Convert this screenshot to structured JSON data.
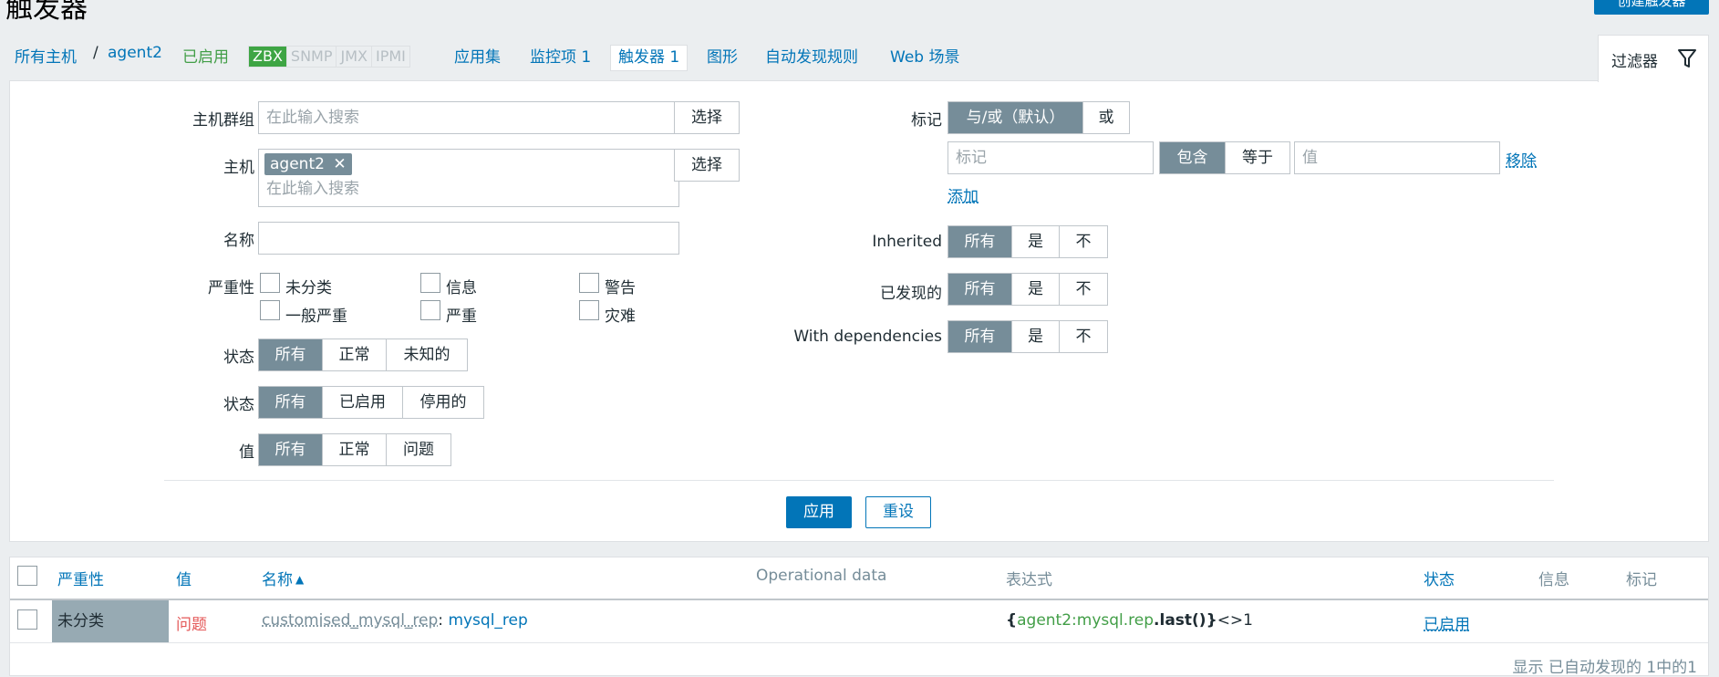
{
  "page": {
    "title": "触发器",
    "create_button": "创建触发器"
  },
  "nav": {
    "all_hosts": "所有主机",
    "separator": "/",
    "host": "agent2",
    "status": "已启用",
    "availability": [
      "ZBX",
      "SNMP",
      "JMX",
      "IPMI"
    ],
    "applications": "应用集",
    "items": "监控项 1",
    "triggers": "触发器 1",
    "graphs": "图形",
    "discovery": "自动发现规则",
    "web": "Web 场景"
  },
  "filter": {
    "tab_label": "过滤器",
    "host_groups_label": "主机群组",
    "host_groups_placeholder": "在此输入搜索",
    "select_button": "选择",
    "host_label": "主机",
    "host_tag": "agent2",
    "host_placeholder": "在此输入搜索",
    "name_label": "名称",
    "name_value": "",
    "severity_label": "严重性",
    "severities": [
      "未分类",
      "信息",
      "警告",
      "一般严重",
      "严重",
      "灾难"
    ],
    "state_label": "状态",
    "state_options": [
      "所有",
      "正常",
      "未知的"
    ],
    "status_label": "状态",
    "status_options": [
      "所有",
      "已启用",
      "停用的"
    ],
    "value_label": "值",
    "value_options": [
      "所有",
      "正常",
      "问题"
    ],
    "tags_label": "标记",
    "tags_operator": [
      "与/或（默认）",
      "或"
    ],
    "tag_placeholder": "标记",
    "tag_match": [
      "包含",
      "等于"
    ],
    "tag_value_placeholder": "值",
    "remove_link": "移除",
    "add_link": "添加",
    "inherited_label": "Inherited",
    "discovered_label": "已发现的",
    "dependencies_label": "With dependencies",
    "tri_options": [
      "所有",
      "是",
      "不"
    ],
    "apply_button": "应用",
    "reset_button": "重设"
  },
  "table": {
    "headers": {
      "severity": "严重性",
      "value": "值",
      "name": "名称",
      "sort_arrow": "▲",
      "operational": "Operational data",
      "expression": "表达式",
      "status": "状态",
      "info": "信息",
      "tags": "标记"
    },
    "rows": [
      {
        "severity": "未分类",
        "value": "问题",
        "name_prefix": "customised_mysql_rep",
        "name_sep": ": ",
        "name": "mysql_rep",
        "expr_open": "{",
        "expr_key": "agent2:mysql.rep",
        "expr_func": ".last()",
        "expr_close": "}",
        "expr_cmp": "<>1",
        "status": "已启用"
      }
    ],
    "footer": "显示 已自动发现的 1中的1"
  },
  "colors": {
    "accent": "#0275b8",
    "enabled": "#429e47",
    "problem": "#e45959",
    "severity_bg": "#97aab3",
    "segment_on": "#768d99"
  }
}
